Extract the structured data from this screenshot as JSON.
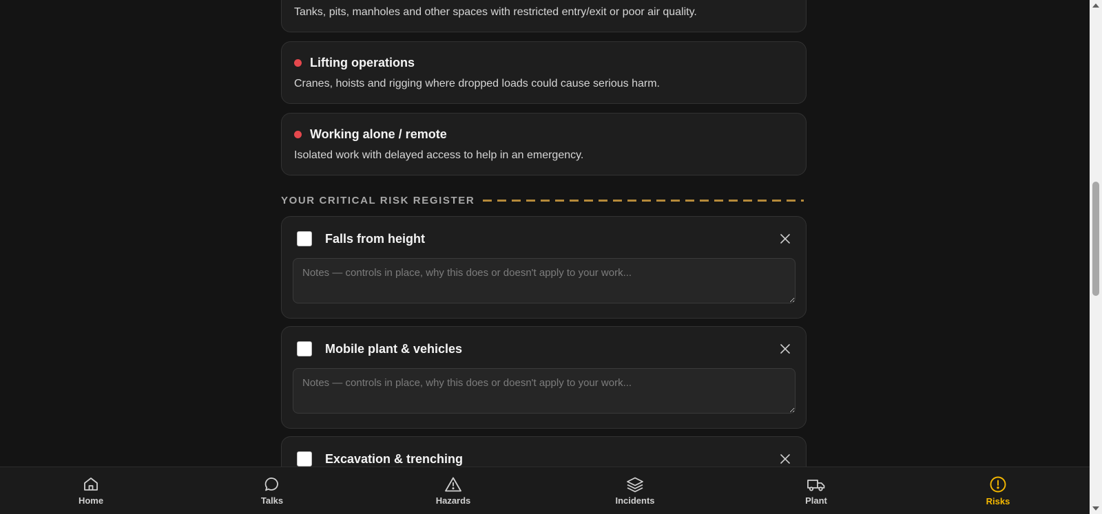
{
  "info_cards": [
    {
      "title": "",
      "description": "Tanks, pits, manholes and other spaces with restricted entry/exit or poor air quality."
    },
    {
      "title": "Lifting operations",
      "description": "Cranes, hoists and rigging where dropped loads could cause serious harm."
    },
    {
      "title": "Working alone / remote",
      "description": "Isolated work with delayed access to help in an emergency."
    }
  ],
  "register": {
    "title": "YOUR CRITICAL RISK REGISTER",
    "notes_placeholder": "Notes — controls in place, why this does or doesn't apply to your work...",
    "items": [
      {
        "title": "Falls from height",
        "checked": false,
        "notes": ""
      },
      {
        "title": "Mobile plant & vehicles",
        "checked": false,
        "notes": ""
      },
      {
        "title": "Excavation & trenching",
        "checked": false,
        "notes": ""
      }
    ]
  },
  "nav": {
    "items": [
      {
        "label": "Home",
        "icon": "home-icon",
        "active": false
      },
      {
        "label": "Talks",
        "icon": "chat-bubble-icon",
        "active": false
      },
      {
        "label": "Hazards",
        "icon": "warning-triangle-icon",
        "active": false
      },
      {
        "label": "Incidents",
        "icon": "layers-icon",
        "active": false
      },
      {
        "label": "Plant",
        "icon": "truck-icon",
        "active": false
      },
      {
        "label": "Risks",
        "icon": "alert-circle-icon",
        "active": true
      }
    ]
  },
  "colors": {
    "background": "#141414",
    "card": "#1e1e1e",
    "risk_dot": "#e5484d",
    "accent": "#f5b800",
    "hazard_stripe": "#b58a3a"
  }
}
